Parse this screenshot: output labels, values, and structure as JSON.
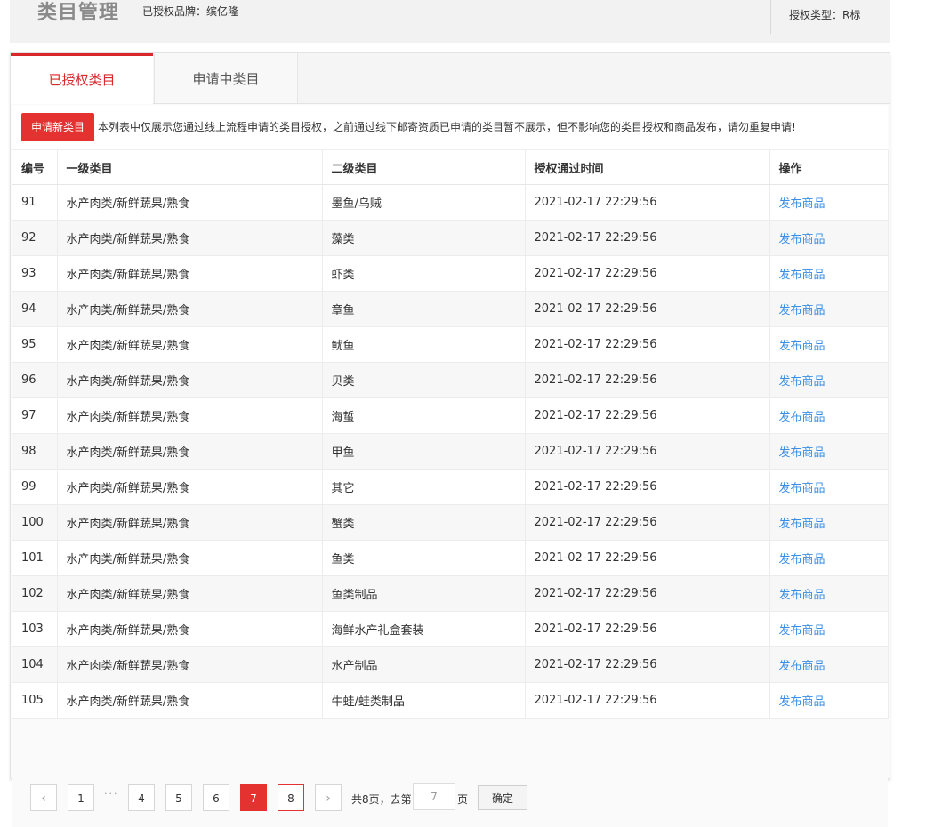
{
  "header": {
    "title": "类目管理",
    "brand": "已授权品牌：缤亿隆",
    "auth_type": "授权类型：R标"
  },
  "tabs": [
    {
      "label": "已授权类目",
      "active": true
    },
    {
      "label": "申请中类目",
      "active": false
    }
  ],
  "notice": {
    "apply_button": "申请新类目",
    "text": "本列表中仅展示您通过线上流程申请的类目授权，之前通过线下邮寄资质已申请的类目暂不展示，但不影响您的类目授权和商品发布，请勿重复申请!"
  },
  "table": {
    "headers": [
      "编号",
      "一级类目",
      "二级类目",
      "授权通过时间",
      "操作"
    ],
    "rows": [
      {
        "id": "91",
        "level1": "水产肉类/新鲜蔬果/熟食",
        "level2": "墨鱼/乌贼",
        "time": "2021-02-17 22:29:56",
        "action": "发布商品"
      },
      {
        "id": "92",
        "level1": "水产肉类/新鲜蔬果/熟食",
        "level2": "藻类",
        "time": "2021-02-17 22:29:56",
        "action": "发布商品"
      },
      {
        "id": "93",
        "level1": "水产肉类/新鲜蔬果/熟食",
        "level2": "虾类",
        "time": "2021-02-17 22:29:56",
        "action": "发布商品"
      },
      {
        "id": "94",
        "level1": "水产肉类/新鲜蔬果/熟食",
        "level2": "章鱼",
        "time": "2021-02-17 22:29:56",
        "action": "发布商品"
      },
      {
        "id": "95",
        "level1": "水产肉类/新鲜蔬果/熟食",
        "level2": "鱿鱼",
        "time": "2021-02-17 22:29:56",
        "action": "发布商品"
      },
      {
        "id": "96",
        "level1": "水产肉类/新鲜蔬果/熟食",
        "level2": "贝类",
        "time": "2021-02-17 22:29:56",
        "action": "发布商品"
      },
      {
        "id": "97",
        "level1": "水产肉类/新鲜蔬果/熟食",
        "level2": "海蜇",
        "time": "2021-02-17 22:29:56",
        "action": "发布商品"
      },
      {
        "id": "98",
        "level1": "水产肉类/新鲜蔬果/熟食",
        "level2": "甲鱼",
        "time": "2021-02-17 22:29:56",
        "action": "发布商品"
      },
      {
        "id": "99",
        "level1": "水产肉类/新鲜蔬果/熟食",
        "level2": "其它",
        "time": "2021-02-17 22:29:56",
        "action": "发布商品"
      },
      {
        "id": "100",
        "level1": "水产肉类/新鲜蔬果/熟食",
        "level2": "蟹类",
        "time": "2021-02-17 22:29:56",
        "action": "发布商品"
      },
      {
        "id": "101",
        "level1": "水产肉类/新鲜蔬果/熟食",
        "level2": "鱼类",
        "time": "2021-02-17 22:29:56",
        "action": "发布商品"
      },
      {
        "id": "102",
        "level1": "水产肉类/新鲜蔬果/熟食",
        "level2": "鱼类制品",
        "time": "2021-02-17 22:29:56",
        "action": "发布商品"
      },
      {
        "id": "103",
        "level1": "水产肉类/新鲜蔬果/熟食",
        "level2": "海鲜水产礼盒套装",
        "time": "2021-02-17 22:29:56",
        "action": "发布商品"
      },
      {
        "id": "104",
        "level1": "水产肉类/新鲜蔬果/熟食",
        "level2": "水产制品",
        "time": "2021-02-17 22:29:56",
        "action": "发布商品"
      },
      {
        "id": "105",
        "level1": "水产肉类/新鲜蔬果/熟食",
        "level2": "牛蛙/蛙类制品",
        "time": "2021-02-17 22:29:56",
        "action": "发布商品"
      }
    ]
  },
  "pagination": {
    "prev_icon": "‹",
    "next_icon": "›",
    "pages": [
      "1",
      "4",
      "5",
      "6",
      "7",
      "8"
    ],
    "current_page": "7",
    "ellipsis": "···",
    "total_text": "共8页，去第",
    "goto_value": "7",
    "page_suffix": "页",
    "confirm_label": "确定"
  },
  "colors": {
    "accent": "#e3322f",
    "link": "#3a8ee6"
  }
}
